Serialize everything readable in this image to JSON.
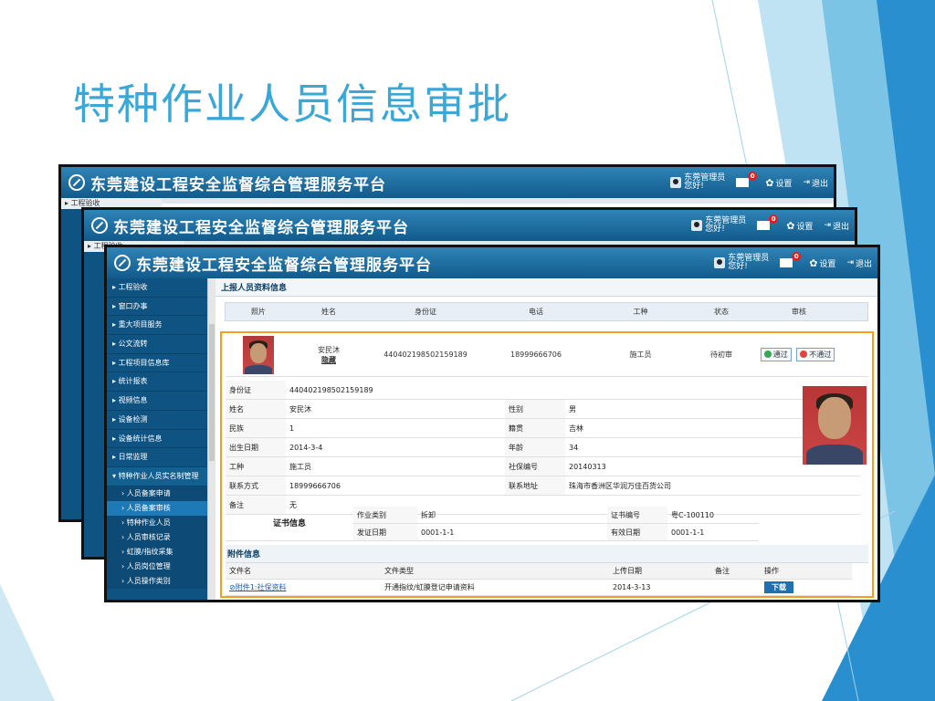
{
  "slide": {
    "title": "特种作业人员信息审批",
    "colors": {
      "title": "#3aa7d6",
      "accent": "#2a8fcf",
      "header": "#115a8c"
    }
  },
  "app": {
    "title": "东莞建设工程安全监督综合管理服务平台",
    "user_name": "东莞管理员",
    "user_greeting": "您好!",
    "mail_count": "0",
    "settings_label": "设置",
    "logout_label": "退出"
  },
  "sidebar_top_tab": "工程验收",
  "sidebar": [
    {
      "label": "工程验收"
    },
    {
      "label": "窗口办事"
    },
    {
      "label": "重大项目服务"
    },
    {
      "label": "公文流转"
    },
    {
      "label": "工程项目信息库"
    },
    {
      "label": "统计报表"
    },
    {
      "label": "视频信息"
    },
    {
      "label": "设备检测"
    },
    {
      "label": "设备统计信息"
    },
    {
      "label": "日常监理"
    },
    {
      "label": "特种作业人员实名制管理"
    }
  ],
  "sidebar_sub": [
    {
      "label": "人员备案申请"
    },
    {
      "label": "人员备案审核"
    },
    {
      "label": "特种作业人员"
    },
    {
      "label": "人员审核记录"
    },
    {
      "label": "虹膜/指纹采集"
    },
    {
      "label": "人员岗位管理"
    },
    {
      "label": "人员操作类别"
    }
  ],
  "section_title": "上报人员资料信息",
  "table_headers": [
    "照片",
    "姓名",
    "身份证",
    "电话",
    "工种",
    "状态",
    "审核"
  ],
  "person": {
    "name": "安民沐",
    "hide_link": "隐藏",
    "id": "440402198502159189",
    "phone": "18999666706",
    "type": "施工员",
    "status": "待初审",
    "approve": "通过",
    "reject": "不通过"
  },
  "info_rows": [
    {
      "k1": "身份证",
      "v1": "440402198502159189",
      "k2": "",
      "v2": ""
    },
    {
      "k1": "姓名",
      "v1": "安民沐",
      "k2": "性别",
      "v2": "男"
    },
    {
      "k1": "民族",
      "v1": "1",
      "k2": "籍贯",
      "v2": "吉林"
    },
    {
      "k1": "出生日期",
      "v1": "2014-3-4",
      "k2": "年龄",
      "v2": "34"
    },
    {
      "k1": "工种",
      "v1": "施工员",
      "k2": "社保编号",
      "v2": "20140313"
    },
    {
      "k1": "联系方式",
      "v1": "18999666706",
      "k2": "联系地址",
      "v2": "珠海市香洲区华润万佳百货公司"
    },
    {
      "k1": "备注",
      "v1": "无",
      "k2": "",
      "v2": ""
    }
  ],
  "cert": {
    "label": "证书信息",
    "rows": [
      {
        "k1": "作业类别",
        "v1": "拆卸",
        "k2": "证书编号",
        "v2": "粤C-100110"
      },
      {
        "k1": "发证日期",
        "v1": "0001-1-1",
        "k2": "有效日期",
        "v2": "0001-1-1"
      }
    ]
  },
  "attachments": {
    "title": "附件信息",
    "headers": [
      "文件名",
      "文件类型",
      "上传日期",
      "备注",
      "操作"
    ],
    "rows": [
      {
        "file": "附件1:社保资料",
        "type": "开通指纹/虹膜登记申请资料",
        "date": "2014-3-13",
        "note": "",
        "action": "下载"
      }
    ]
  }
}
